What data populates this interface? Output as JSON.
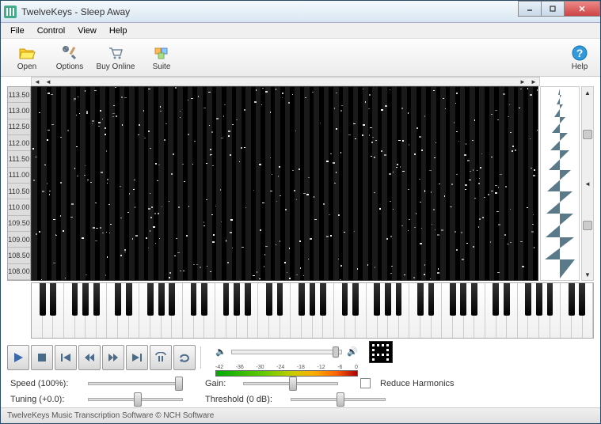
{
  "window": {
    "title": "TwelveKeys - Sleep Away"
  },
  "menu": {
    "file": "File",
    "control": "Control",
    "view": "View",
    "help": "Help"
  },
  "toolbar": {
    "open": "Open",
    "options": "Options",
    "buy": "Buy Online",
    "suite": "Suite",
    "help": "Help"
  },
  "time_axis": [
    "113.50",
    "113.00",
    "112.50",
    "112.00",
    "111.50",
    "111.00",
    "110.50",
    "110.00",
    "109.50",
    "109.00",
    "108.50",
    "108.00"
  ],
  "db_labels": [
    "-42",
    "-36",
    "-30",
    "-24",
    "-18",
    "-12",
    "-6",
    "0"
  ],
  "params": {
    "speed_label": "Speed (100%):",
    "gain_label": "Gain:",
    "reduce_harmonics": "Reduce Harmonics",
    "tuning_label": "Tuning (+0.0):",
    "threshold_label": "Threshold (0 dB):"
  },
  "status": {
    "text": "TwelveKeys Music Transcription Software   © NCH Software"
  }
}
